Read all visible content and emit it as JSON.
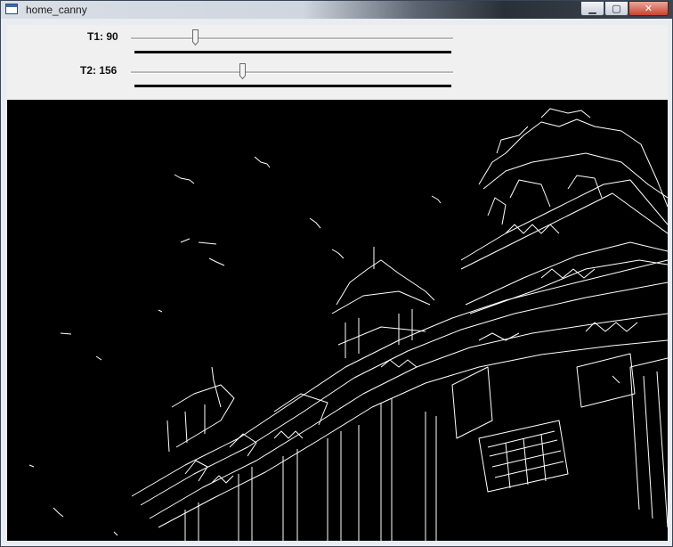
{
  "window": {
    "title": "home_canny"
  },
  "titlebar_buttons": {
    "minimize": "▁",
    "maximize": "▢",
    "close": "✕"
  },
  "trackbars": [
    {
      "label": "T1: 90",
      "value": 90,
      "max": 450
    },
    {
      "label": "T2: 156",
      "value": 156,
      "max": 450
    }
  ],
  "image": {
    "description_icon": "canny-edge-image"
  }
}
